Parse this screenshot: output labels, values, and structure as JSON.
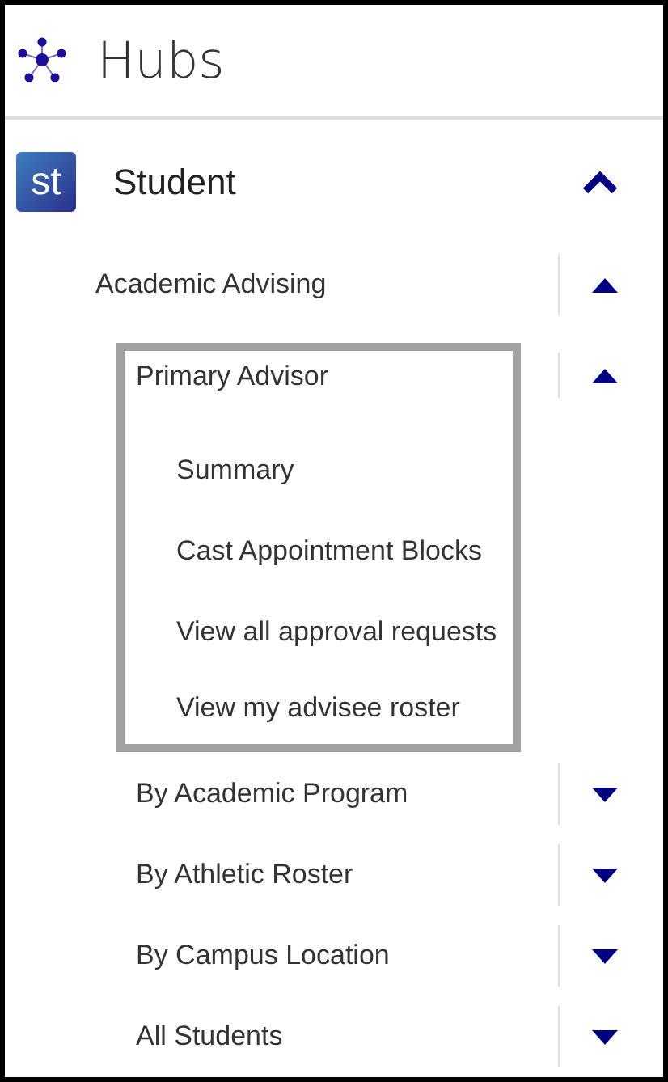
{
  "header": {
    "title": "Hubs"
  },
  "hub": {
    "badge": "st",
    "label": "Student",
    "expanded": true,
    "groups": [
      {
        "label": "Academic Advising",
        "expanded": true,
        "items": [
          {
            "label": "Primary Advisor",
            "expanded": true,
            "highlighted": true,
            "links": [
              "Summary",
              "Cast Appointment Blocks",
              "View all approval requests",
              "View my advisee roster"
            ]
          },
          {
            "label": "By Academic Program",
            "expanded": false,
            "highlighted": false
          },
          {
            "label": "By Athletic Roster",
            "expanded": false,
            "highlighted": false
          },
          {
            "label": "By Campus Location",
            "expanded": false,
            "highlighted": false
          },
          {
            "label": "All Students",
            "expanded": false,
            "highlighted": false
          }
        ]
      }
    ]
  }
}
